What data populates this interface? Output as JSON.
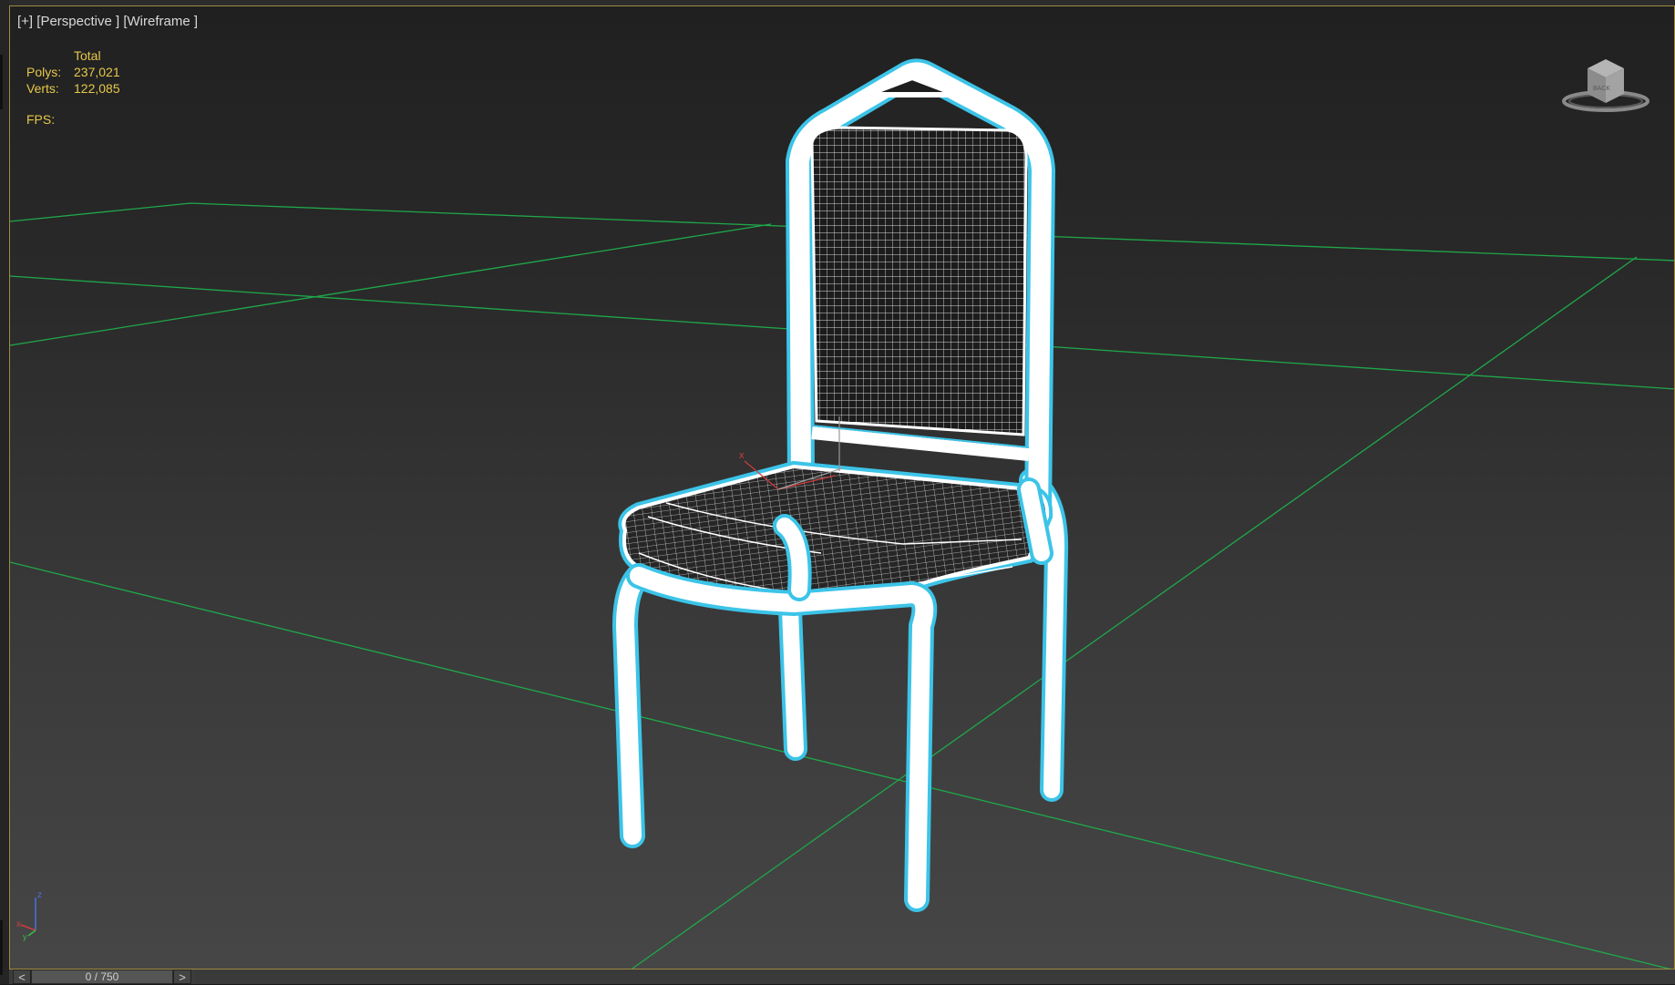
{
  "viewport": {
    "label_plus": "[+]",
    "label_view": "[Perspective ]",
    "label_shading": "[Wireframe ]"
  },
  "stats": {
    "header": "Total",
    "polys_label": "Polys:",
    "polys_value": "237,021",
    "verts_label": "Verts:",
    "verts_value": "122,085",
    "fps_label": "FPS:"
  },
  "viewcube": {
    "face_label": "BACK"
  },
  "gizmo": {
    "x_label": "x"
  },
  "axis_tripod": {
    "x_label": "x",
    "y_label": "y",
    "z_label": "z"
  },
  "timebar": {
    "prev_label": "<",
    "next_label": ">",
    "frame_display": "0 / 750"
  },
  "colors": {
    "viewport_border": "#a0893e",
    "stats_text": "#e6c84a",
    "grid_lines": "#1fa84a",
    "selection_halo": "#3cc4e8",
    "wire": "#ffffff"
  },
  "icons": [
    "viewcube-icon",
    "axis-tripod-icon",
    "transform-gizmo-icon"
  ]
}
